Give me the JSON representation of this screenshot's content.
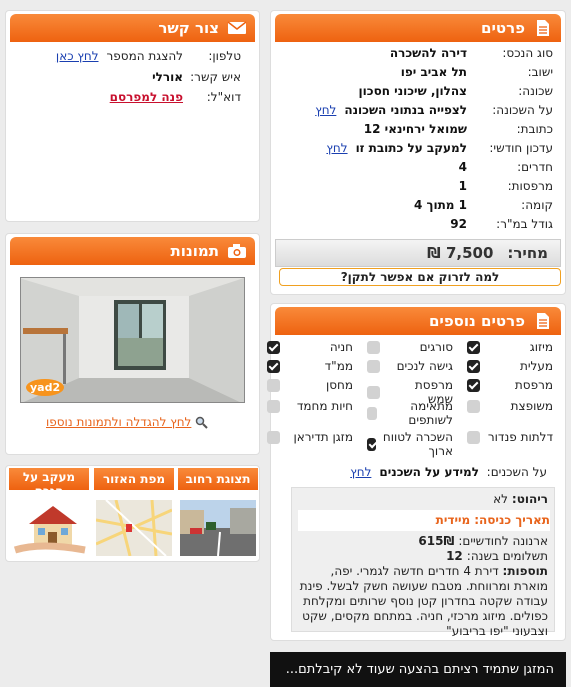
{
  "details": {
    "title": "פרטים",
    "rows": [
      {
        "label": "סוג הנכס:",
        "value": "דירה להשכרה"
      },
      {
        "label": "ישוב:",
        "value": "תל אביב יפו"
      },
      {
        "label": "שכונה:",
        "value": "צהלון, שיכוני חסכון"
      },
      {
        "label": "על השכונה:",
        "value": "לצפייה בנתוני השכונה",
        "link": "לחץ"
      },
      {
        "label": "כתובת:",
        "value": "שמואל ירחינאי 12"
      },
      {
        "label": "עדכון חודשי:",
        "value": "למעקב על כתובת זו",
        "link": "לחץ"
      },
      {
        "label": "חדרים:",
        "value": "4"
      },
      {
        "label": "מרפסות:",
        "value": "1"
      },
      {
        "label": "קומה:",
        "value": "1 מתוך 4"
      },
      {
        "label": "גודל במ\"ר:",
        "value": "92"
      }
    ],
    "price_label": "מחיר:",
    "price_value": "7,500 ₪",
    "fix_link": "למה לזרוק אם אפשר לתקן?"
  },
  "contact": {
    "title": "צור קשר",
    "phone_label": "טלפון:",
    "phone_text": "להצגת המספר",
    "phone_link": "לחץ כאן",
    "person_label": "איש קשר:",
    "person_value": "אורלי",
    "email_label": "דוא\"ל:",
    "email_link": "פנה למפרסם"
  },
  "photos": {
    "title": "תמונות",
    "watermark": "yad2",
    "enlarge_link": "לחץ להגדלה ולתמונות נוספו"
  },
  "tabs": [
    {
      "label": "תצוגת רחוב"
    },
    {
      "label": "מפת האזור"
    },
    {
      "label": "מעקב על הנכס"
    }
  ],
  "extra": {
    "title": "פרטים נוספים",
    "features": [
      {
        "label": "מיזוג",
        "checked": true
      },
      {
        "label": "סורגים",
        "checked": false
      },
      {
        "label": "חניה",
        "checked": true
      },
      {
        "label": "מעלית",
        "checked": true
      },
      {
        "label": "גישה לנכים",
        "checked": false
      },
      {
        "label": "ממ\"ד",
        "checked": true
      },
      {
        "label": "מרפסת",
        "checked": true
      },
      {
        "label": "מרפסת שמש",
        "checked": false
      },
      {
        "label": "מחסן",
        "checked": false
      },
      {
        "label": "משופצת",
        "checked": false
      },
      {
        "label": "מתאימה לשותפים",
        "checked": false
      },
      {
        "label": "חיות מחמד",
        "checked": false
      },
      {
        "label": "דלתות פנדור",
        "checked": false
      },
      {
        "label": "השכרה לטווח ארוך",
        "checked": true
      },
      {
        "label": "מזגן תדיראן",
        "checked": false
      }
    ],
    "tenants_label": "על השכנים:",
    "tenants_value": "למידע על השכנים",
    "tenants_link": "לחץ",
    "furniture_label": "ריהוט:",
    "furniture_value": "לא",
    "entry_label": "תאריך כניסה:",
    "entry_value": "מיידית",
    "arnona_label": "ארנונה לחודשיים:",
    "arnona_value": "615₪",
    "payments_label": "תשלומים בשנה:",
    "payments_value": "12",
    "additions_label": "תוספות:",
    "additions_text": "דירת 4 חדרים חדשה לגמרי. יפה, מוארת ומרווחת. מטבח שעושה חשק לבשל. פינת עבודה שקטה בחדרון קטן נוסף שרותים ומקלחת כפולים. מיזוג מרכזי, חניה. במתחם מקסים, שקט וצבעוני \"יפו בריבוע\""
  },
  "banner": {
    "text": "המזגן שתמיד רציתם בהצעה שעוד לא קיבלתם..."
  }
}
